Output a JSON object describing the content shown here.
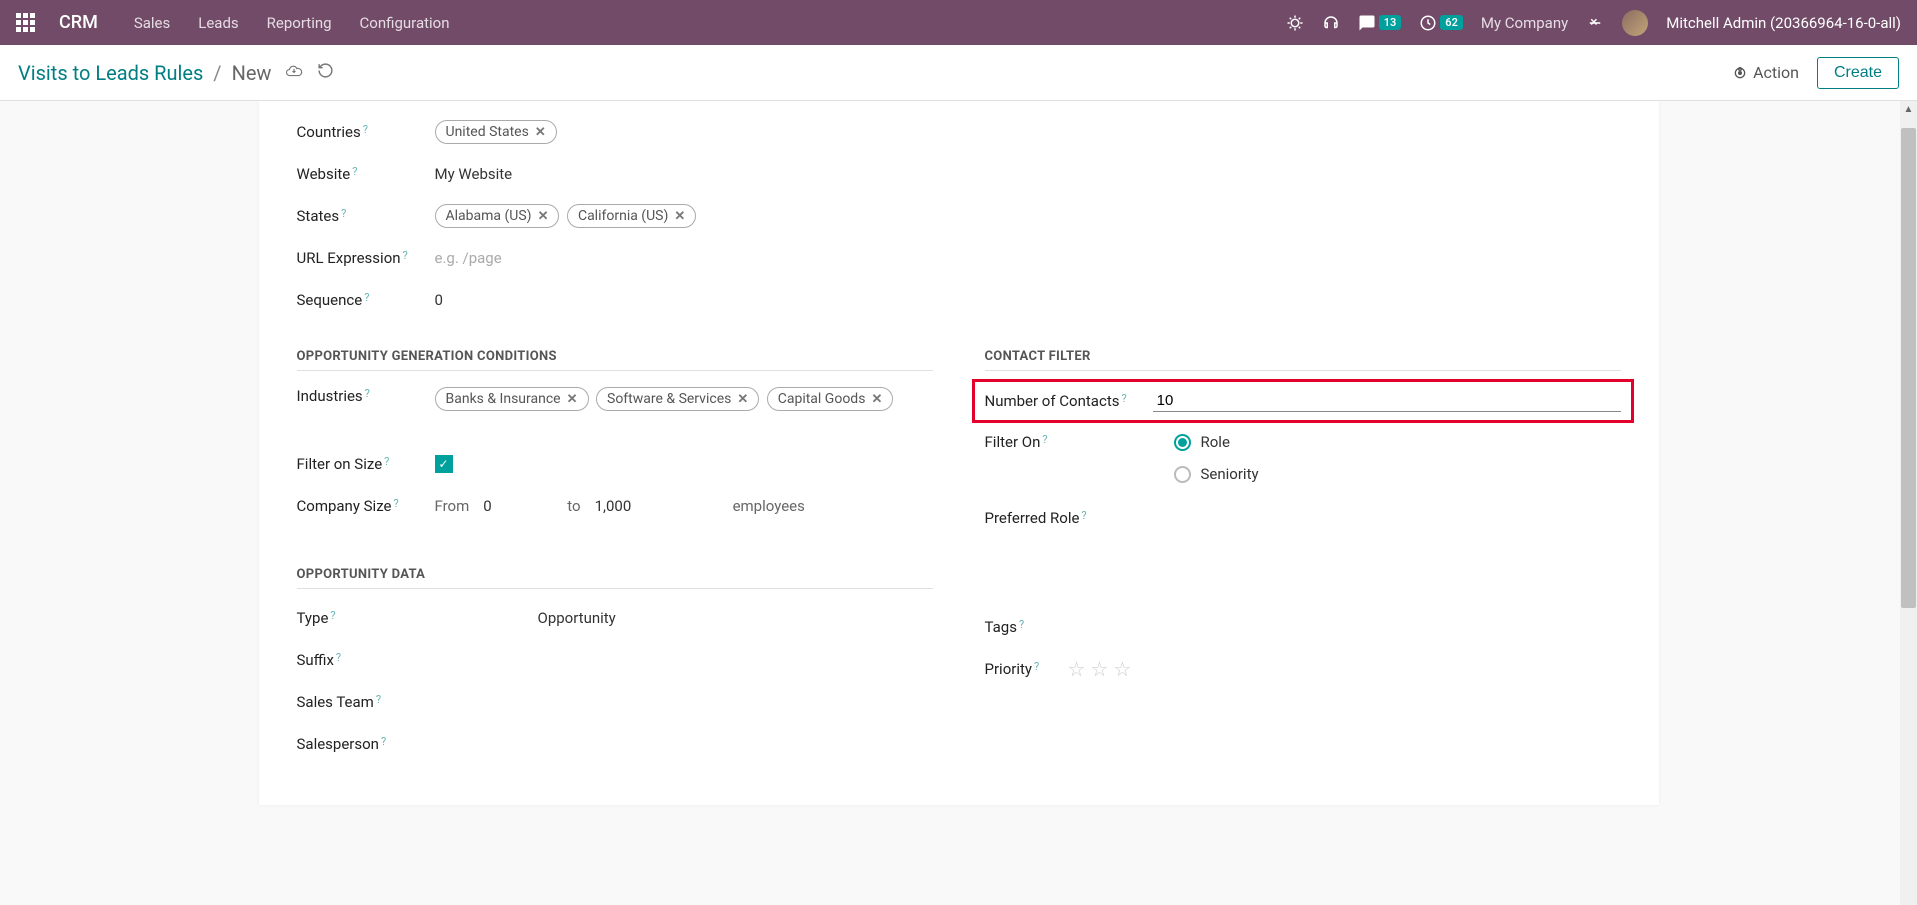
{
  "topbar": {
    "app_name": "CRM",
    "nav": [
      "Sales",
      "Leads",
      "Reporting",
      "Configuration"
    ],
    "msg_badge": "13",
    "clock_badge": "62",
    "company": "My Company",
    "user": "Mitchell Admin (20366964-16-0-all)"
  },
  "subheader": {
    "breadcrumb_parent": "Visits to Leads Rules",
    "breadcrumb_current": "New",
    "action_label": "Action",
    "create_label": "Create"
  },
  "fields": {
    "countries_label": "Countries",
    "countries_tags": [
      "United States"
    ],
    "website_label": "Website",
    "website_value": "My Website",
    "states_label": "States",
    "states_tags": [
      "Alabama (US)",
      "California (US)"
    ],
    "url_expr_label": "URL Expression",
    "url_expr_placeholder": "e.g. /page",
    "sequence_label": "Sequence",
    "sequence_value": "0"
  },
  "section_gen": "OPPORTUNITY GENERATION CONDITIONS",
  "section_contact": "CONTACT FILTER",
  "industries_label": "Industries",
  "industries_tags": [
    "Banks & Insurance",
    "Software & Services",
    "Capital Goods"
  ],
  "filter_size_label": "Filter on Size",
  "company_size_label": "Company Size",
  "size_from_label": "From",
  "size_from_value": "0",
  "size_to_label": "to",
  "size_to_value": "1,000",
  "size_unit": "employees",
  "num_contacts_label": "Number of Contacts",
  "num_contacts_value": "10",
  "filter_on_label": "Filter On",
  "filter_on_options": [
    "Role",
    "Seniority"
  ],
  "preferred_role_label": "Preferred Role",
  "section_data": "OPPORTUNITY DATA",
  "type_label": "Type",
  "type_value": "Opportunity",
  "suffix_label": "Suffix",
  "sales_team_label": "Sales Team",
  "salesperson_label": "Salesperson",
  "tags_label": "Tags",
  "priority_label": "Priority"
}
